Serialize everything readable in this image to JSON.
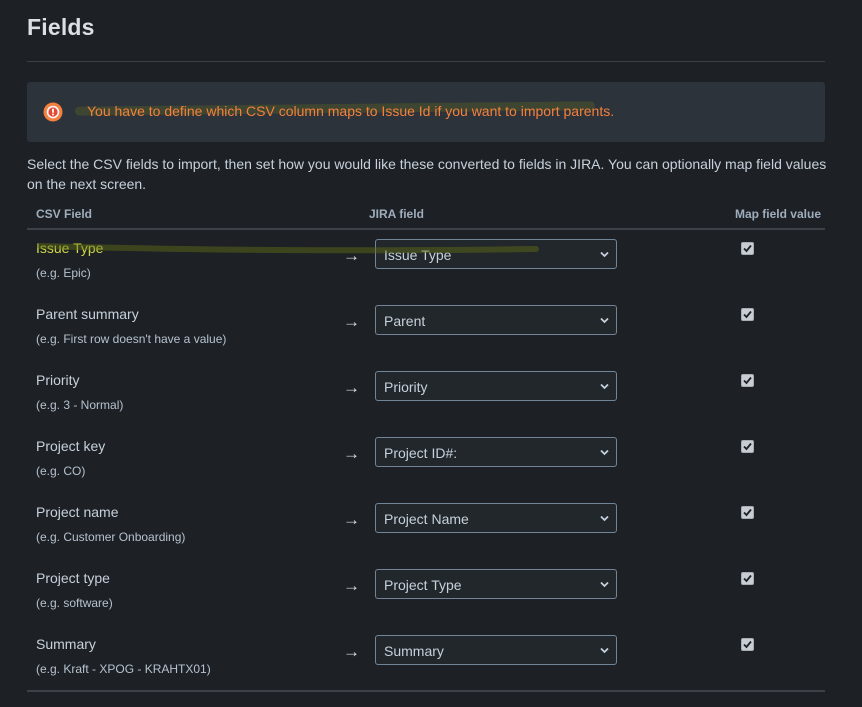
{
  "page": {
    "title": "Fields"
  },
  "warning": {
    "icon": "warning-icon",
    "text": "You have to define which CSV column maps to Issue Id if you want to import parents.",
    "color": "#f5803d"
  },
  "intro": {
    "text": "Select the CSV fields to import, then set how you would like these converted to fields in JIRA. You can optionally map field values on the next screen."
  },
  "table": {
    "headers": {
      "csv_field": "CSV Field",
      "jira_field": "JIRA field",
      "map_value": "Map field value"
    },
    "arrow": "→",
    "rows": [
      {
        "csv_field": "Issue Type",
        "example": "(e.g. Epic)",
        "jira_field": "Issue Type",
        "map_value": true
      },
      {
        "csv_field": "Parent summary",
        "example": "(e.g. First row doesn't have a value)",
        "jira_field": "Parent",
        "map_value": true
      },
      {
        "csv_field": "Priority",
        "example": "(e.g. 3 - Normal)",
        "jira_field": "Priority",
        "map_value": true
      },
      {
        "csv_field": "Project key",
        "example": "(e.g. CO)",
        "jira_field": "Project ID#:",
        "map_value": true
      },
      {
        "csv_field": "Project name",
        "example": "(e.g. Customer Onboarding)",
        "jira_field": "Project Name",
        "map_value": true
      },
      {
        "csv_field": "Project type",
        "example": "(e.g. software)",
        "jira_field": "Project Type",
        "map_value": true
      },
      {
        "csv_field": "Summary",
        "example": "(e.g. Kraft - XPOG - KRAHTX01)",
        "jira_field": "Summary",
        "map_value": true
      }
    ]
  }
}
